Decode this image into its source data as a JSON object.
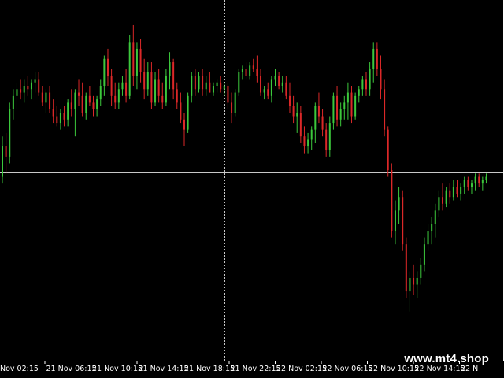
{
  "chart_data": {
    "type": "candlestick",
    "title": "",
    "xlabel": "",
    "ylabel": "",
    "grid": false,
    "colors": {
      "background": "#000000",
      "bull": "#3cc83c",
      "bear": "#dc2828",
      "frame": "#ffffff",
      "tick_text": "#ffffff",
      "crosshair": "#c8c8c8"
    },
    "x_ticks": [
      "Nov 02:15",
      "21 Nov 06:15",
      "21 Nov 10:15",
      "21 Nov 14:15",
      "21 Nov 18:15",
      "21 Nov 22:15",
      "22 Nov 02:15",
      "22 Nov 06:15",
      "22 Nov 10:15",
      "22 Nov 14:15",
      "22 N"
    ],
    "price_range": [
      0,
      100
    ],
    "crosshair": {
      "candle_index": 61,
      "price": 49.3
    },
    "candles": [
      {
        "o": 48,
        "h": 60,
        "l": 46,
        "c": 57
      },
      {
        "o": 57,
        "h": 61,
        "l": 49,
        "c": 54
      },
      {
        "o": 54,
        "h": 70,
        "l": 52,
        "c": 68
      },
      {
        "o": 68,
        "h": 74,
        "l": 65,
        "c": 72
      },
      {
        "o": 72,
        "h": 76,
        "l": 68,
        "c": 74
      },
      {
        "o": 74,
        "h": 77,
        "l": 71,
        "c": 73
      },
      {
        "o": 73,
        "h": 77,
        "l": 70,
        "c": 75
      },
      {
        "o": 75,
        "h": 78,
        "l": 72,
        "c": 74
      },
      {
        "o": 74,
        "h": 77,
        "l": 71,
        "c": 76
      },
      {
        "o": 76,
        "h": 79,
        "l": 73,
        "c": 77
      },
      {
        "o": 77,
        "h": 79,
        "l": 72,
        "c": 73
      },
      {
        "o": 73,
        "h": 75,
        "l": 69,
        "c": 70
      },
      {
        "o": 70,
        "h": 74,
        "l": 67,
        "c": 73
      },
      {
        "o": 73,
        "h": 75,
        "l": 67,
        "c": 68
      },
      {
        "o": 68,
        "h": 71,
        "l": 64,
        "c": 66
      },
      {
        "o": 66,
        "h": 69,
        "l": 63,
        "c": 64
      },
      {
        "o": 64,
        "h": 68,
        "l": 62,
        "c": 67
      },
      {
        "o": 67,
        "h": 69,
        "l": 63,
        "c": 65
      },
      {
        "o": 65,
        "h": 71,
        "l": 63,
        "c": 70
      },
      {
        "o": 70,
        "h": 74,
        "l": 66,
        "c": 68
      },
      {
        "o": 68,
        "h": 74,
        "l": 60,
        "c": 73
      },
      {
        "o": 73,
        "h": 77,
        "l": 69,
        "c": 72
      },
      {
        "o": 72,
        "h": 76,
        "l": 66,
        "c": 67
      },
      {
        "o": 67,
        "h": 73,
        "l": 65,
        "c": 72
      },
      {
        "o": 72,
        "h": 75,
        "l": 69,
        "c": 70
      },
      {
        "o": 70,
        "h": 72,
        "l": 66,
        "c": 68
      },
      {
        "o": 68,
        "h": 72,
        "l": 66,
        "c": 71
      },
      {
        "o": 71,
        "h": 77,
        "l": 69,
        "c": 75
      },
      {
        "o": 75,
        "h": 84,
        "l": 72,
        "c": 83
      },
      {
        "o": 83,
        "h": 86,
        "l": 75,
        "c": 78
      },
      {
        "o": 78,
        "h": 80,
        "l": 69,
        "c": 72
      },
      {
        "o": 72,
        "h": 76,
        "l": 68,
        "c": 70
      },
      {
        "o": 70,
        "h": 76,
        "l": 68,
        "c": 74
      },
      {
        "o": 74,
        "h": 78,
        "l": 72,
        "c": 76
      },
      {
        "o": 76,
        "h": 80,
        "l": 70,
        "c": 72
      },
      {
        "o": 72,
        "h": 90,
        "l": 71,
        "c": 88
      },
      {
        "o": 88,
        "h": 93,
        "l": 75,
        "c": 78
      },
      {
        "o": 78,
        "h": 88,
        "l": 74,
        "c": 86
      },
      {
        "o": 86,
        "h": 89,
        "l": 76,
        "c": 79
      },
      {
        "o": 79,
        "h": 83,
        "l": 71,
        "c": 74
      },
      {
        "o": 74,
        "h": 82,
        "l": 72,
        "c": 79
      },
      {
        "o": 79,
        "h": 82,
        "l": 68,
        "c": 70
      },
      {
        "o": 70,
        "h": 79,
        "l": 69,
        "c": 77
      },
      {
        "o": 77,
        "h": 80,
        "l": 70,
        "c": 72
      },
      {
        "o": 72,
        "h": 76,
        "l": 68,
        "c": 70
      },
      {
        "o": 70,
        "h": 80,
        "l": 69,
        "c": 78
      },
      {
        "o": 78,
        "h": 85,
        "l": 74,
        "c": 82
      },
      {
        "o": 82,
        "h": 83,
        "l": 71,
        "c": 74
      },
      {
        "o": 74,
        "h": 76,
        "l": 68,
        "c": 70
      },
      {
        "o": 70,
        "h": 73,
        "l": 64,
        "c": 65
      },
      {
        "o": 65,
        "h": 67,
        "l": 57,
        "c": 62
      },
      {
        "o": 62,
        "h": 73,
        "l": 61,
        "c": 72
      },
      {
        "o": 72,
        "h": 79,
        "l": 70,
        "c": 78
      },
      {
        "o": 78,
        "h": 80,
        "l": 72,
        "c": 74
      },
      {
        "o": 74,
        "h": 79,
        "l": 73,
        "c": 78
      },
      {
        "o": 78,
        "h": 80,
        "l": 72,
        "c": 74
      },
      {
        "o": 74,
        "h": 78,
        "l": 72,
        "c": 76
      },
      {
        "o": 76,
        "h": 79,
        "l": 73,
        "c": 73
      },
      {
        "o": 73,
        "h": 76,
        "l": 72,
        "c": 75
      },
      {
        "o": 75,
        "h": 77,
        "l": 73,
        "c": 76
      },
      {
        "o": 76,
        "h": 78,
        "l": 73,
        "c": 74
      },
      {
        "o": 74,
        "h": 76,
        "l": 72,
        "c": 75
      },
      {
        "o": 75,
        "h": 76,
        "l": 68,
        "c": 70
      },
      {
        "o": 70,
        "h": 73,
        "l": 64,
        "c": 67
      },
      {
        "o": 67,
        "h": 74,
        "l": 66,
        "c": 73
      },
      {
        "o": 73,
        "h": 80,
        "l": 72,
        "c": 79
      },
      {
        "o": 79,
        "h": 81,
        "l": 77,
        "c": 80
      },
      {
        "o": 80,
        "h": 82,
        "l": 77,
        "c": 78
      },
      {
        "o": 78,
        "h": 82,
        "l": 77,
        "c": 81
      },
      {
        "o": 81,
        "h": 83,
        "l": 79,
        "c": 80
      },
      {
        "o": 80,
        "h": 84,
        "l": 76,
        "c": 78
      },
      {
        "o": 78,
        "h": 80,
        "l": 72,
        "c": 73
      },
      {
        "o": 73,
        "h": 75,
        "l": 71,
        "c": 74
      },
      {
        "o": 74,
        "h": 76,
        "l": 71,
        "c": 72
      },
      {
        "o": 72,
        "h": 78,
        "l": 70,
        "c": 77
      },
      {
        "o": 77,
        "h": 80,
        "l": 75,
        "c": 78
      },
      {
        "o": 78,
        "h": 79,
        "l": 74,
        "c": 75
      },
      {
        "o": 75,
        "h": 78,
        "l": 73,
        "c": 76
      },
      {
        "o": 76,
        "h": 78,
        "l": 71,
        "c": 72
      },
      {
        "o": 72,
        "h": 76,
        "l": 67,
        "c": 69
      },
      {
        "o": 69,
        "h": 72,
        "l": 64,
        "c": 66
      },
      {
        "o": 66,
        "h": 70,
        "l": 61,
        "c": 67
      },
      {
        "o": 67,
        "h": 69,
        "l": 58,
        "c": 60
      },
      {
        "o": 60,
        "h": 63,
        "l": 55,
        "c": 57
      },
      {
        "o": 57,
        "h": 61,
        "l": 55,
        "c": 59
      },
      {
        "o": 59,
        "h": 63,
        "l": 56,
        "c": 62
      },
      {
        "o": 62,
        "h": 70,
        "l": 58,
        "c": 69
      },
      {
        "o": 69,
        "h": 73,
        "l": 64,
        "c": 66
      },
      {
        "o": 66,
        "h": 68,
        "l": 60,
        "c": 62
      },
      {
        "o": 62,
        "h": 64,
        "l": 54,
        "c": 56
      },
      {
        "o": 56,
        "h": 66,
        "l": 54,
        "c": 64
      },
      {
        "o": 64,
        "h": 73,
        "l": 62,
        "c": 72
      },
      {
        "o": 72,
        "h": 75,
        "l": 63,
        "c": 65
      },
      {
        "o": 65,
        "h": 70,
        "l": 63,
        "c": 68
      },
      {
        "o": 68,
        "h": 72,
        "l": 65,
        "c": 70
      },
      {
        "o": 70,
        "h": 76,
        "l": 65,
        "c": 73
      },
      {
        "o": 73,
        "h": 75,
        "l": 64,
        "c": 66
      },
      {
        "o": 66,
        "h": 73,
        "l": 65,
        "c": 72
      },
      {
        "o": 72,
        "h": 75,
        "l": 70,
        "c": 74
      },
      {
        "o": 74,
        "h": 78,
        "l": 72,
        "c": 77
      },
      {
        "o": 77,
        "h": 79,
        "l": 72,
        "c": 74
      },
      {
        "o": 74,
        "h": 82,
        "l": 72,
        "c": 80
      },
      {
        "o": 80,
        "h": 88,
        "l": 76,
        "c": 86
      },
      {
        "o": 86,
        "h": 88,
        "l": 78,
        "c": 80
      },
      {
        "o": 80,
        "h": 84,
        "l": 71,
        "c": 74
      },
      {
        "o": 74,
        "h": 77,
        "l": 60,
        "c": 62
      },
      {
        "o": 62,
        "h": 63,
        "l": 48,
        "c": 50
      },
      {
        "o": 50,
        "h": 52,
        "l": 30,
        "c": 32
      },
      {
        "o": 32,
        "h": 41,
        "l": 28,
        "c": 38
      },
      {
        "o": 38,
        "h": 45,
        "l": 34,
        "c": 42
      },
      {
        "o": 42,
        "h": 44,
        "l": 26,
        "c": 28
      },
      {
        "o": 28,
        "h": 30,
        "l": 12,
        "c": 14
      },
      {
        "o": 14,
        "h": 20,
        "l": 8,
        "c": 18
      },
      {
        "o": 18,
        "h": 22,
        "l": 13,
        "c": 16
      },
      {
        "o": 16,
        "h": 20,
        "l": 12,
        "c": 18
      },
      {
        "o": 18,
        "h": 24,
        "l": 16,
        "c": 22
      },
      {
        "o": 22,
        "h": 30,
        "l": 20,
        "c": 28
      },
      {
        "o": 28,
        "h": 34,
        "l": 26,
        "c": 32
      },
      {
        "o": 32,
        "h": 36,
        "l": 28,
        "c": 34
      },
      {
        "o": 34,
        "h": 40,
        "l": 30,
        "c": 38
      },
      {
        "o": 38,
        "h": 44,
        "l": 36,
        "c": 42
      },
      {
        "o": 42,
        "h": 46,
        "l": 38,
        "c": 40
      },
      {
        "o": 40,
        "h": 45,
        "l": 39,
        "c": 44
      },
      {
        "o": 44,
        "h": 46,
        "l": 40,
        "c": 42
      },
      {
        "o": 42,
        "h": 47,
        "l": 41,
        "c": 45
      },
      {
        "o": 45,
        "h": 47,
        "l": 42,
        "c": 43
      },
      {
        "o": 43,
        "h": 46,
        "l": 41,
        "c": 45
      },
      {
        "o": 45,
        "h": 48,
        "l": 43,
        "c": 47
      },
      {
        "o": 47,
        "h": 48,
        "l": 44,
        "c": 45
      },
      {
        "o": 45,
        "h": 47,
        "l": 43,
        "c": 46
      },
      {
        "o": 46,
        "h": 49,
        "l": 44,
        "c": 48
      },
      {
        "o": 48,
        "h": 49,
        "l": 45,
        "c": 46
      },
      {
        "o": 46,
        "h": 48,
        "l": 44,
        "c": 47
      },
      {
        "o": 47,
        "h": 49,
        "l": 46,
        "c": 48
      }
    ]
  },
  "watermark": "www.mt4.shop"
}
